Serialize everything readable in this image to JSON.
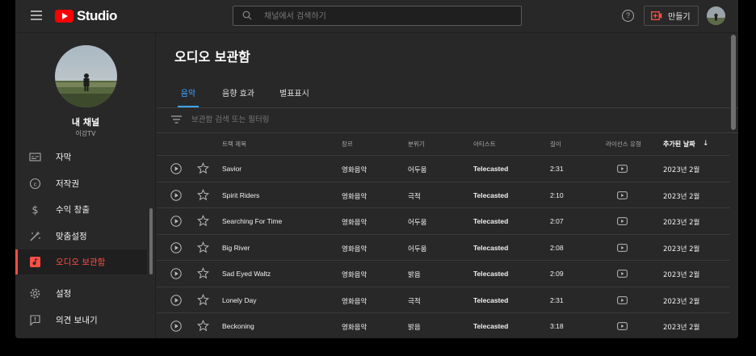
{
  "header": {
    "logo_text": "Studio",
    "search_placeholder": "채널에서 검색하기",
    "help_glyph": "?",
    "create_label": "만들기"
  },
  "sidebar": {
    "channel_title": "내 채널",
    "channel_name": "이강TV",
    "items": [
      {
        "label": "자막",
        "icon": "subtitles-icon",
        "active": false
      },
      {
        "label": "저작권",
        "icon": "copyright-icon",
        "active": false
      },
      {
        "label": "수익 창출",
        "icon": "dollar-icon",
        "active": false
      },
      {
        "label": "맞춤설정",
        "icon": "magic-wand-icon",
        "active": false
      },
      {
        "label": "오디오 보관함",
        "icon": "audio-library-icon",
        "active": true
      },
      {
        "label": "설정",
        "icon": "gear-icon",
        "active": false
      },
      {
        "label": "의견 보내기",
        "icon": "feedback-icon",
        "active": false
      }
    ]
  },
  "main": {
    "title": "오디오 보관함",
    "tabs": [
      {
        "label": "음악",
        "active": true
      },
      {
        "label": "음향 효과",
        "active": false
      },
      {
        "label": "별표표시",
        "active": false
      }
    ],
    "filter_placeholder": "보관함 검색 또는 필터링",
    "columns": {
      "title": "트랙 제목",
      "genre": "장르",
      "mood": "분위기",
      "artist": "아티스트",
      "duration": "길이",
      "license": "라이선스 유형",
      "added": "추가된 날짜",
      "sort_arrow": "↓"
    },
    "tracks": [
      {
        "title": "Savior",
        "genre": "영화음악",
        "mood": "어두움",
        "artist": "Telecasted",
        "duration": "2:31",
        "added": "2023년 2월"
      },
      {
        "title": "Spirit Riders",
        "genre": "영화음악",
        "mood": "극적",
        "artist": "Telecasted",
        "duration": "2:10",
        "added": "2023년 2월"
      },
      {
        "title": "Searching For Time",
        "genre": "영화음악",
        "mood": "어두움",
        "artist": "Telecasted",
        "duration": "2:07",
        "added": "2023년 2월"
      },
      {
        "title": "Big River",
        "genre": "영화음악",
        "mood": "어두움",
        "artist": "Telecasted",
        "duration": "2:08",
        "added": "2023년 2월"
      },
      {
        "title": "Sad Eyed Waltz",
        "genre": "영화음악",
        "mood": "밝음",
        "artist": "Telecasted",
        "duration": "2:09",
        "added": "2023년 2월"
      },
      {
        "title": "Lonely Day",
        "genre": "영화음악",
        "mood": "극적",
        "artist": "Telecasted",
        "duration": "2:31",
        "added": "2023년 2월"
      },
      {
        "title": "Beckoning",
        "genre": "영화음악",
        "mood": "밝음",
        "artist": "Telecasted",
        "duration": "3:18",
        "added": "2023년 2월"
      }
    ]
  },
  "colors": {
    "accent_red": "#ff4e45",
    "tab_blue": "#3ea6ff",
    "youtube_red": "#ff0000"
  }
}
